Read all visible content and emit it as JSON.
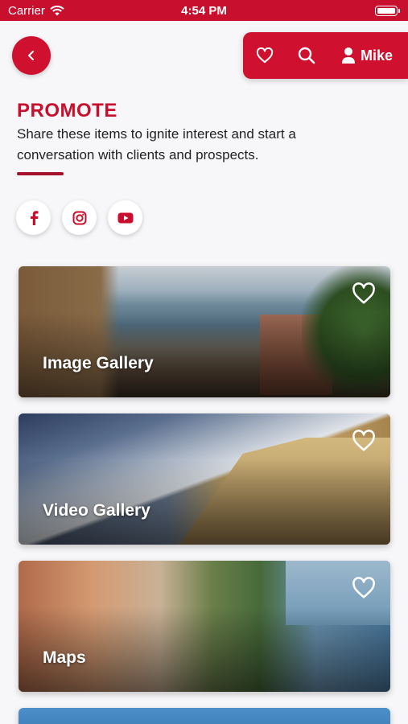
{
  "status_bar": {
    "carrier": "Carrier",
    "time": "4:54 PM"
  },
  "header": {
    "user_name": "Mike"
  },
  "promote": {
    "title": "PROMOTE",
    "description": "Share these items to ignite interest and start a conversation with clients and prospects."
  },
  "social": [
    "facebook-icon",
    "instagram-icon",
    "youtube-icon"
  ],
  "cards": [
    {
      "title": "Image Gallery"
    },
    {
      "title": "Video Gallery"
    },
    {
      "title": "Maps"
    }
  ],
  "colors": {
    "brand": "#c8102e",
    "background": "#f7f7f9"
  }
}
